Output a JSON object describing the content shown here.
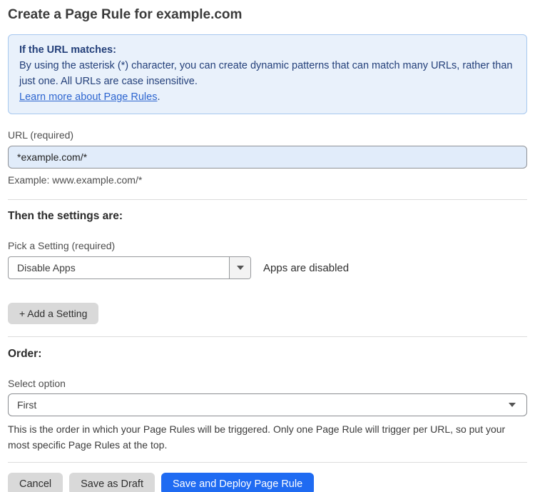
{
  "page": {
    "title": "Create a Page Rule for example.com"
  },
  "info_box": {
    "heading": "If the URL matches:",
    "body": "By using the asterisk (*) character, you can create dynamic patterns that can match many URLs, rather than just one. All URLs are case insensitive.",
    "link_label": "Learn more about Page Rules",
    "link_suffix": "."
  },
  "url_field": {
    "label": "URL (required)",
    "value": "*example.com/*",
    "example": "Example: www.example.com/*"
  },
  "settings_section": {
    "heading": "Then the settings are:",
    "picker_label": "Pick a Setting (required)",
    "picker_value": "Disable Apps",
    "picker_status": "Apps are disabled",
    "add_setting_label": "+ Add a Setting"
  },
  "order_section": {
    "heading": "Order:",
    "select_label": "Select option",
    "select_value": "First",
    "help_text": "This is the order in which your Page Rules will be triggered. Only one Page Rule will trigger per URL, so put your most specific Page Rules at the top."
  },
  "footer": {
    "cancel_label": "Cancel",
    "save_draft_label": "Save as Draft",
    "save_deploy_label": "Save and Deploy Page Rule"
  },
  "colors": {
    "primary_blue": "#1f6bf2",
    "info_bg": "#e9f1fb",
    "info_border": "#a7c8ef",
    "info_text": "#24407a",
    "link_blue": "#2e66d0",
    "input_bg": "#e1ecfa",
    "button_gray": "#d9d9d9"
  }
}
